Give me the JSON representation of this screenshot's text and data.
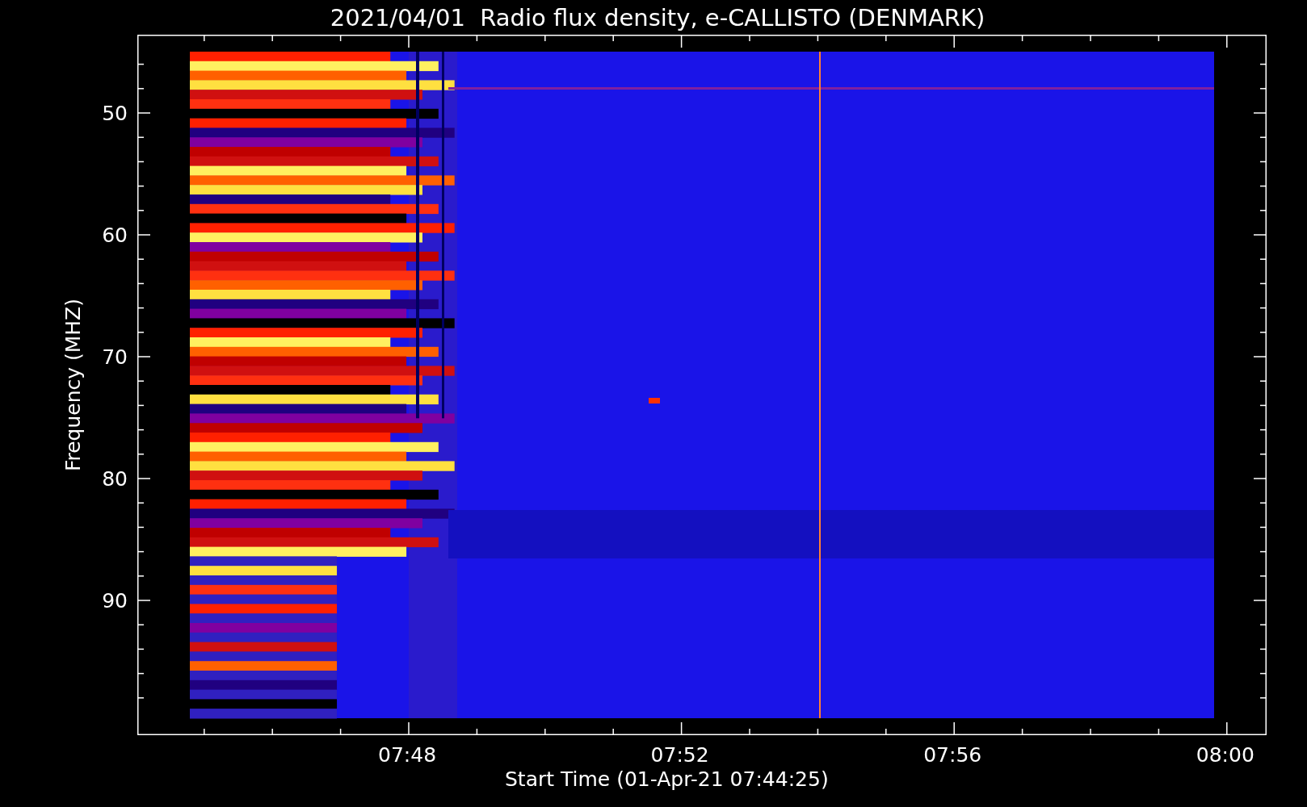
{
  "title": "2021/04/01  Radio flux density, e-CALLISTO (DENMARK)",
  "plot": {
    "ylabel": "Frequency (MHZ)",
    "xlabel": "Start Time (01-Apr-21 07:44:25)",
    "yticks": [
      "50",
      "60",
      "70",
      "80",
      "90"
    ],
    "xticks": [
      "07:48",
      "07:52",
      "07:56",
      "08:00"
    ]
  }
}
